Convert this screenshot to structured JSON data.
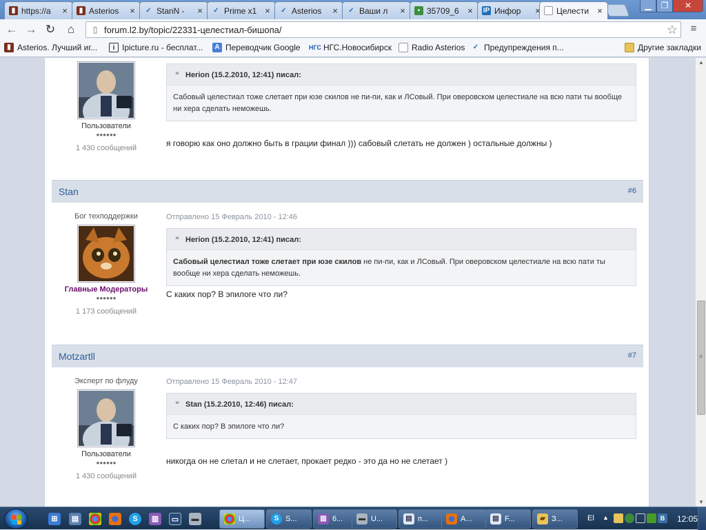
{
  "browser": {
    "tabs": [
      {
        "label": "https://a",
        "icon": "asterios-favicon-icon",
        "color": "#7a2f1c"
      },
      {
        "label": "Asterios",
        "icon": "asterios-favicon-icon",
        "color": "#7a2f1c"
      },
      {
        "label": "StanN -",
        "icon": "vk-check-favicon-icon",
        "color": "#2b6cb0"
      },
      {
        "label": "Prime x1",
        "icon": "vk-check-favicon-icon",
        "color": "#2b6cb0"
      },
      {
        "label": "Asterios",
        "icon": "vk-check-favicon-icon",
        "color": "#2b6cb0"
      },
      {
        "label": "Ваши л",
        "icon": "vk-check-favicon-icon",
        "color": "#2b6cb0"
      },
      {
        "label": "35709_6",
        "icon": "image-favicon-icon",
        "color": "#3f8d3f"
      },
      {
        "label": "Инфор",
        "icon": "ip-favicon-icon",
        "color": "#1f6fb3"
      },
      {
        "label": "Целести",
        "icon": "page-favicon-icon",
        "color": "#888888"
      }
    ],
    "close_glyph": "×",
    "url": "forum.l2.by/topic/22331-целестиал-бишопа/",
    "bookmarks": [
      {
        "label": "Asterios. Лучший иг...",
        "icon": "asterios-bookmark-icon"
      },
      {
        "label": "Ipicture.ru - бесплат...",
        "icon": "ipicture-bookmark-icon"
      },
      {
        "label": "Переводчик Google",
        "icon": "google-translate-bookmark-icon"
      },
      {
        "label": "НГС.Новосибирск",
        "icon": "ngs-bookmark-icon"
      },
      {
        "label": "Radio Asterios",
        "icon": "page-bookmark-icon"
      },
      {
        "label": "Предупреждения п...",
        "icon": "vk-bookmark-icon"
      }
    ],
    "other_bookmarks": "Другие закладки"
  },
  "posts": [
    {
      "group": "Пользователи",
      "pips": "●●●●●●",
      "postcount": "1 430 сообщений",
      "quote_header": "Herion (15.2.2010, 12:41) писал:",
      "quote_text": "Сабовый целестиал тоже слетает при юзе скилов не пи-пи, как и ЛСовый. При оверовском целестиале на всю пати ты вообще ни хера сделать неможешь.",
      "body": "я говорю как оно должно быть в грации финал ))) сабовый слетать не должен ) остальные должны )"
    },
    {
      "author": "Stan",
      "num": "#6",
      "rank": "Бог техподдержки",
      "group": "Главные Модераторы",
      "pips": "●●●●●●",
      "postcount": "1 173 сообщений",
      "posted": "Отправлено 15 Февраль 2010 - 12:46",
      "quote_header": "Herion (15.2.2010, 12:41) писал:",
      "quote_bold": "Сабовый целестиал тоже слетает при юзе скилов",
      "quote_rest": " не пи-пи, как и ЛСовый. При оверовском целестиале на всю пати ты вообще ни хера сделать неможешь.",
      "body": "С каких пор? В эпилоге что ли?"
    },
    {
      "author": "Motzartll",
      "num": "#7",
      "rank": "Эксперт по флуду",
      "group": "Пользователи",
      "pips": "●●●●●●",
      "postcount": "1 430 сообщений",
      "posted": "Отправлено 15 Февраль 2010 - 12:47",
      "quote_header": "Stan (15.2.2010, 12:46) писал:",
      "quote_text": "С каких пор? В эпилоге что ли?",
      "body": "никогда он не слетал и не слетает, прокает редко - это да но не слетает )"
    }
  ],
  "taskbar": {
    "buttons": [
      {
        "label": "Ц...",
        "icon": "chrome-icon",
        "active": true
      },
      {
        "label": "S...",
        "icon": "skype-icon"
      },
      {
        "label": "6...",
        "icon": "winrar-icon"
      },
      {
        "label": "U...",
        "icon": "drive-icon"
      },
      {
        "label": "п...",
        "icon": "document-icon"
      },
      {
        "label": "A...",
        "icon": "firefox-icon"
      },
      {
        "label": "F...",
        "icon": "document-icon"
      },
      {
        "label": "З...",
        "icon": "folder-icon"
      }
    ],
    "lang": "El",
    "tray_vk": "B",
    "time": "12:05"
  }
}
